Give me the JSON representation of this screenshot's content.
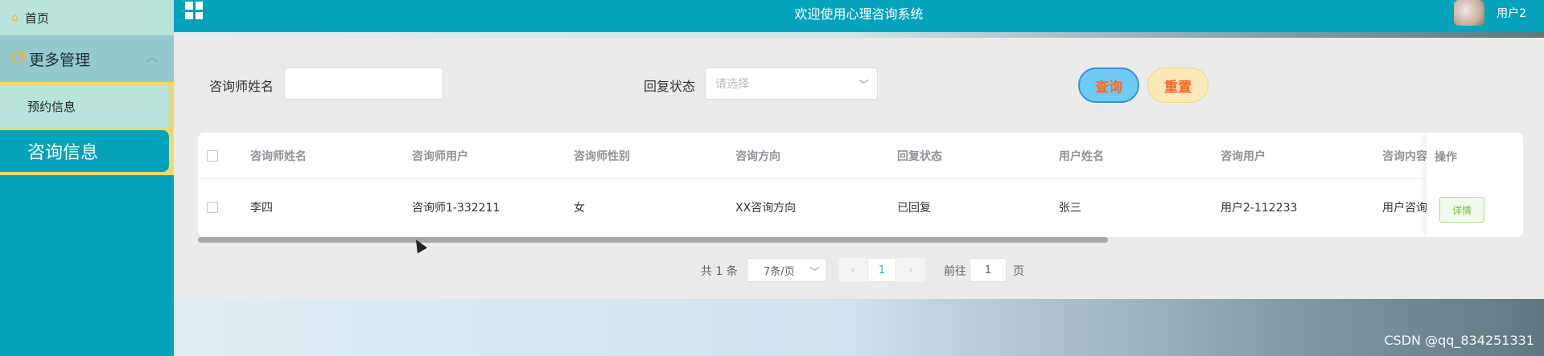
{
  "sidebar": {
    "home": "首页",
    "group": "更多管理",
    "sub_items": [
      "预约信息",
      "咨询信息"
    ]
  },
  "topbar": {
    "title": "欢迎使用心理咨询系统",
    "user": "用户2"
  },
  "search": {
    "name_label": "咨询师姓名",
    "name_value": "",
    "status_label": "回复状态",
    "status_placeholder": "请选择",
    "query_button": "查询",
    "reset_button": "重置"
  },
  "table": {
    "columns": [
      "咨询师姓名",
      "咨询师用户",
      "咨询师性别",
      "咨询方向",
      "回复状态",
      "用户姓名",
      "咨询用户",
      "咨询内容"
    ],
    "op_header": "操作",
    "rows": [
      {
        "cells": [
          "李四",
          "咨询师1-332211",
          "女",
          "XX咨询方向",
          "已回复",
          "张三",
          "用户2-112233",
          "用户咨询"
        ],
        "action": "详情"
      }
    ]
  },
  "pagination": {
    "total": "共 1 条",
    "page_size": "7条/页",
    "current_page": "1",
    "goto_label": "前往",
    "goto_value": "1",
    "page_suffix": "页"
  },
  "watermark": "CSDN @qq_834251331",
  "colors": {
    "sidebar": "#05a3bb",
    "active_item": "#b8e4dc",
    "highlight": "#f3d86a",
    "query_button": "#6fcaf4",
    "reset_button": "#fce9b8"
  },
  "icons": [
    "home-icon",
    "copy-icon",
    "chevron-up-icon",
    "grid-menu-icon",
    "chevron-down-icon",
    "chevron-left-icon",
    "chevron-right-icon"
  ]
}
